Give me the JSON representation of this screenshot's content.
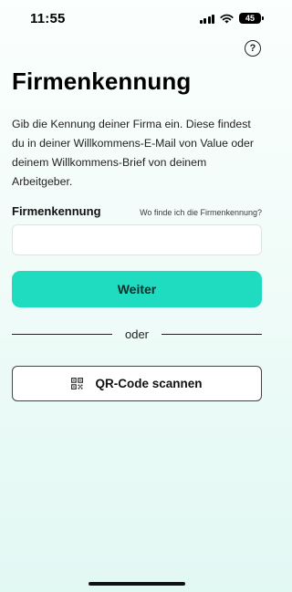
{
  "status_bar": {
    "time": "11:55",
    "battery": "45"
  },
  "page": {
    "title": "Firmenkennung",
    "intro": "Gib die Kennung deiner Firma ein. Diese findest du in deiner Willkommens-E-Mail von Value oder deinem Willkommens-Brief von deinem Arbeitgeber.",
    "field_label": "Firmenkennung",
    "help_link": "Wo finde ich die Firmenkennung?",
    "input_value": "",
    "input_placeholder": "",
    "continue_label": "Weiter",
    "divider_text": "oder",
    "qr_label": "QR-Code scannen",
    "help_icon": "?"
  },
  "colors": {
    "accent": "#1fdcc0",
    "background_bottom": "#e2f8f3"
  }
}
